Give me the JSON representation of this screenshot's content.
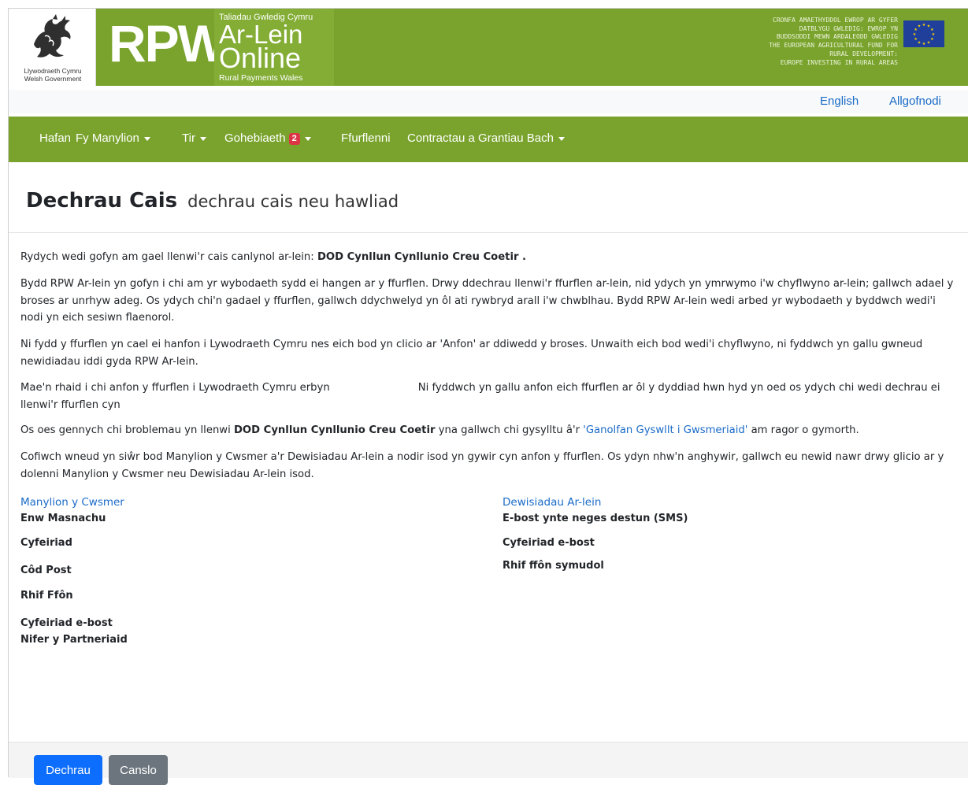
{
  "banner": {
    "wg_logo_line1": "Llywodraeth Cymru",
    "wg_logo_line2": "Welsh Government",
    "rpw_wordmark": "RPW",
    "online_top": "Taliadau Gwledig Cymru",
    "online_arlein": "Ar-Lein",
    "online_online": "Online",
    "online_bottom": "Rural Payments Wales",
    "eu_text_welsh_1": "CRONFA AMAETHYDDOL EWROP AR GYFER",
    "eu_text_welsh_2": "DATBLYGU GWLEDIG: EWROP YN",
    "eu_text_welsh_3": "BUDDSODDI MEWN ARDALEODD GWLEDIG",
    "eu_text_english_1": "THE EUROPEAN AGRICULTURAL FUND FOR",
    "eu_text_english_2": "RURAL DEVELOPMENT:",
    "eu_text_english_3": "EUROPE INVESTING IN RURAL AREAS",
    "colors": {
      "green": "#79a32c",
      "eu_blue": "#1f3f9a",
      "eu_star": "#ffd700"
    }
  },
  "toplinks": {
    "language": "English",
    "logout": "Allgofnodi"
  },
  "nav": {
    "items": [
      {
        "label": "Hafan"
      },
      {
        "label": "Fy Manylion"
      },
      {
        "label": "Tir"
      },
      {
        "label": "Gohebiaeth",
        "badge": "2"
      },
      {
        "label": "Ffurflenni"
      },
      {
        "label": "Contractau a Grantiau Bach"
      }
    ]
  },
  "page": {
    "title": "Dechrau Cais",
    "subtitle": "dechrau cais neu hawliad"
  },
  "paragraphs": {
    "p1_text": "Rydych wedi gofyn am gael llenwi'r cais canlynol ar-lein: ",
    "p1_bold": "DOD Cynllun Cynllunio Creu Coetir .",
    "p2": "Bydd RPW Ar-lein yn gofyn i chi am yr wybodaeth sydd ei hangen ar y ffurflen. Drwy ddechrau llenwi'r ffurflen ar-lein, nid ydych yn ymrwymo i'w chyflwyno ar-lein; gallwch adael y broses ar unrhyw adeg. Os ydych chi'n gadael y ffurflen, gallwch ddychwelyd yn ôl ati rywbryd arall i'w chwblhau. Bydd RPW Ar-lein wedi arbed yr wybodaeth y byddwch wedi'i nodi yn eich sesiwn flaenorol.",
    "p3": "Ni fydd y ffurflen yn cael ei hanfon i Lywodraeth Cymru nes eich bod yn clicio ar 'Anfon' ar ddiwedd y broses. Unwaith eich bod wedi'i chyflwyno, ni fyddwch yn gallu gwneud newidiadau iddi gyda RPW Ar-lein.",
    "p4_part1": "Mae'n rhaid i chi anfon y ffurflen i Lywodraeth Cymru erbyn",
    "p4_part2": "Ni fyddwch yn gallu anfon eich ffurflen ar ôl y dyddiad hwn hyd yn oed os ydych chi wedi dechrau ei llenwi'r ffurflen cyn",
    "p5_text1": "Os oes gennych chi broblemau yn llenwi ",
    "p5_bold": "DOD Cynllun Cynllunio Creu Coetir",
    "p5_text2": " yna gallwch chi gysylltu â'r ",
    "p5_link": "'Ganolfan Gyswllt i Gwsmeriaid'",
    "p5_text3": " am ragor o gymorth.",
    "p6": "Cofiwch wneud yn siŵr bod Manylion y Cwsmer a'r Dewisiadau Ar-lein a nodir isod yn gywir cyn anfon y ffurflen. Os ydyn nhw'n anghywir, gallwch eu newid nawr drwy glicio ar y dolenni Manylion y Cwsmer neu Dewisiadau Ar-lein isod."
  },
  "customer_details": {
    "link": "Manylion y Cwsmer",
    "labels": [
      "Enw Masnachu",
      "Cyfeiriad",
      "Côd Post",
      "Rhif Ffôn",
      "Cyfeiriad e-bost",
      "Nifer y Partneriaid"
    ]
  },
  "online_preferences": {
    "link": "Dewisiadau Ar-lein",
    "labels": [
      "E-bost ynte neges destun (SMS)",
      "Cyfeiriad e-bost",
      "Rhif ffôn symudol"
    ]
  },
  "actions": {
    "start": "Dechrau",
    "cancel": "Canslo"
  }
}
